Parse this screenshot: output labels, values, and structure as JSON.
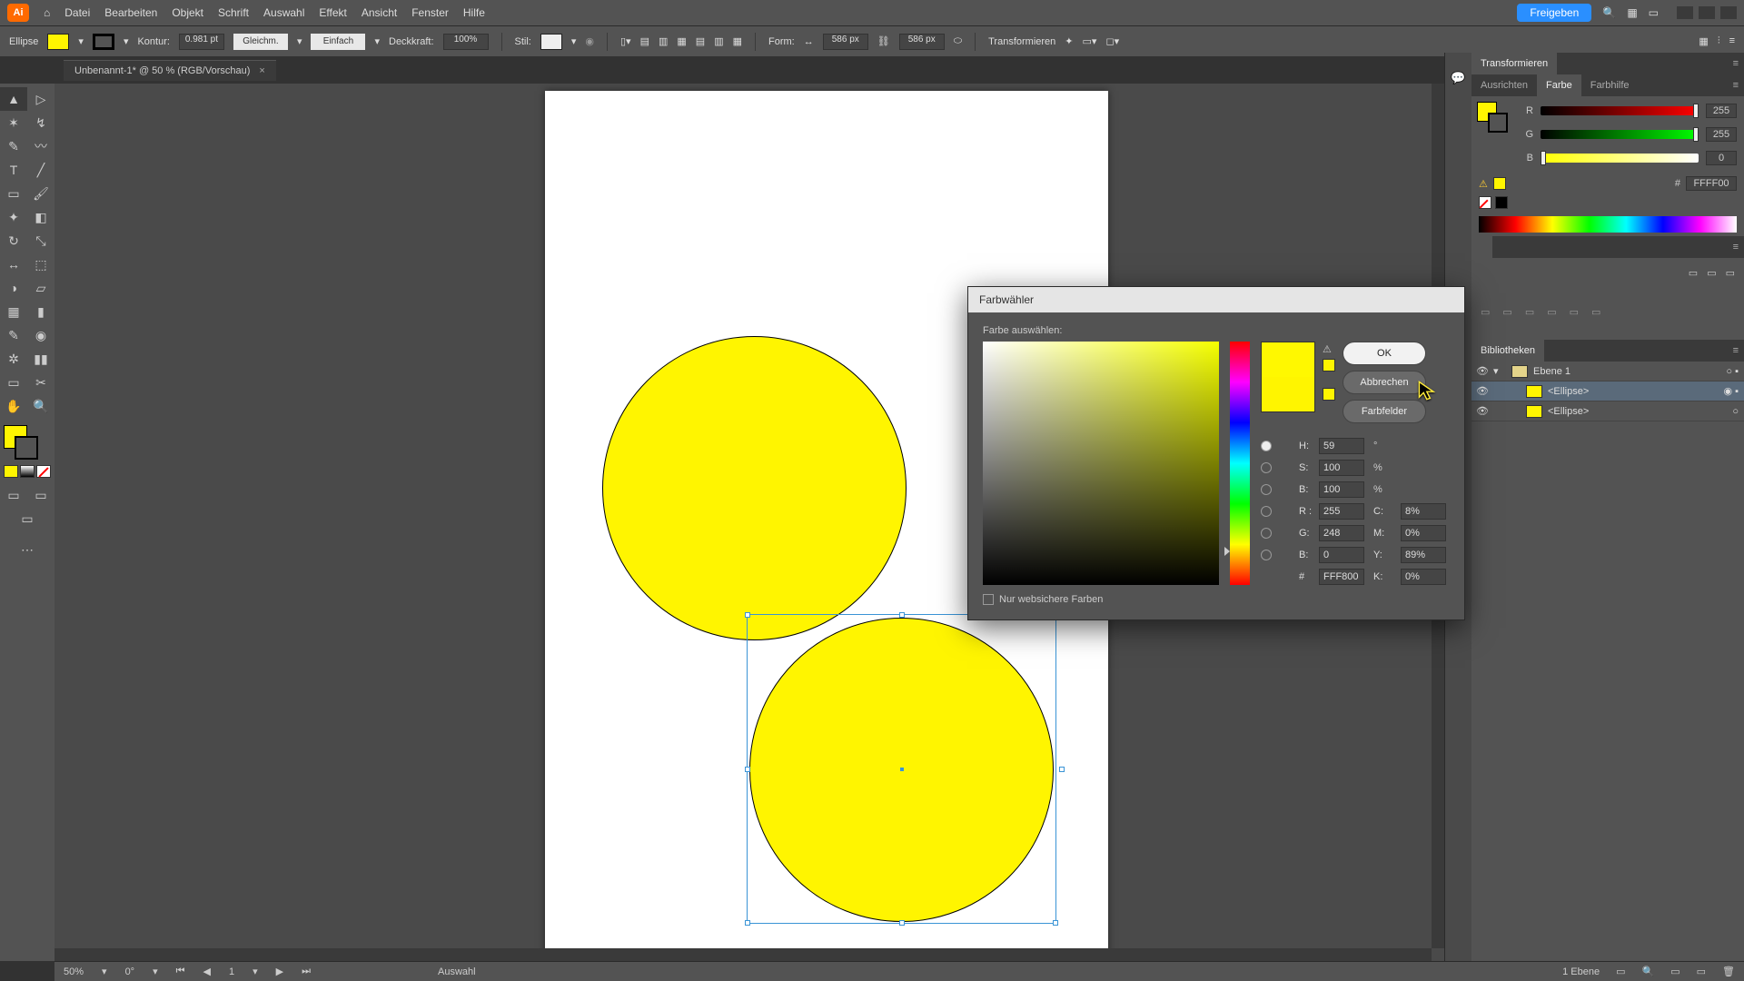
{
  "menubar": {
    "items": [
      "Datei",
      "Bearbeiten",
      "Objekt",
      "Schrift",
      "Auswahl",
      "Effekt",
      "Ansicht",
      "Fenster",
      "Hilfe"
    ],
    "share": "Freigeben"
  },
  "controlbar": {
    "tool_name": "Ellipse",
    "kontur_label": "Kontur:",
    "kontur_val": "0.981 pt",
    "stroke_style1": "Gleichm.",
    "stroke_style2": "Einfach",
    "opacity_label": "Deckkraft:",
    "opacity_val": "100%",
    "stil_label": "Stil:",
    "form_label": "Form:",
    "w_val": "586 px",
    "h_val": "586 px",
    "transform_label": "Transformieren"
  },
  "doc_tab": {
    "name": "Unbenannt-1* @ 50 % (RGB/Vorschau)"
  },
  "color_panel": {
    "tabs": [
      "Ausrichten",
      "Farbe",
      "Farbhilfe"
    ],
    "r_label": "R",
    "g_label": "G",
    "b_label": "B",
    "r_val": "255",
    "g_val": "255",
    "b_val": "0",
    "hex_prefix": "#",
    "hex_val": "FFFF00"
  },
  "transform_tab": "Transformieren",
  "lib_tab": "Bibliotheken",
  "layers": {
    "layer1": "Ebene 1",
    "obj1": "<Ellipse>",
    "obj2": "<Ellipse>",
    "footer": "1 Ebene"
  },
  "dialog": {
    "title": "Farbwähler",
    "choose": "Farbe auswählen:",
    "ok": "OK",
    "cancel": "Abbrechen",
    "swatches": "Farbfelder",
    "h_lbl": "H:",
    "s_lbl": "S:",
    "b_lbl": "B:",
    "r_lbl": "R :",
    "g_lbl": "G:",
    "b2_lbl": "B:",
    "c_lbl": "C:",
    "m_lbl": "M:",
    "y_lbl": "Y:",
    "k_lbl": "K:",
    "hash": "#",
    "h_val": "59",
    "h_unit": "°",
    "s_val": "100",
    "s_unit": "%",
    "bval": "100",
    "b_unit": "%",
    "r_val": "255",
    "g_val": "248",
    "b2_val": "0",
    "c_val": "8%",
    "m_val": "0%",
    "y_val": "89%",
    "k_val": "0%",
    "hex_val": "FFF800",
    "websafe": "Nur websichere Farben"
  },
  "status": {
    "zoom": "50%",
    "angle": "0°",
    "page": "1",
    "tool": "Auswahl"
  }
}
